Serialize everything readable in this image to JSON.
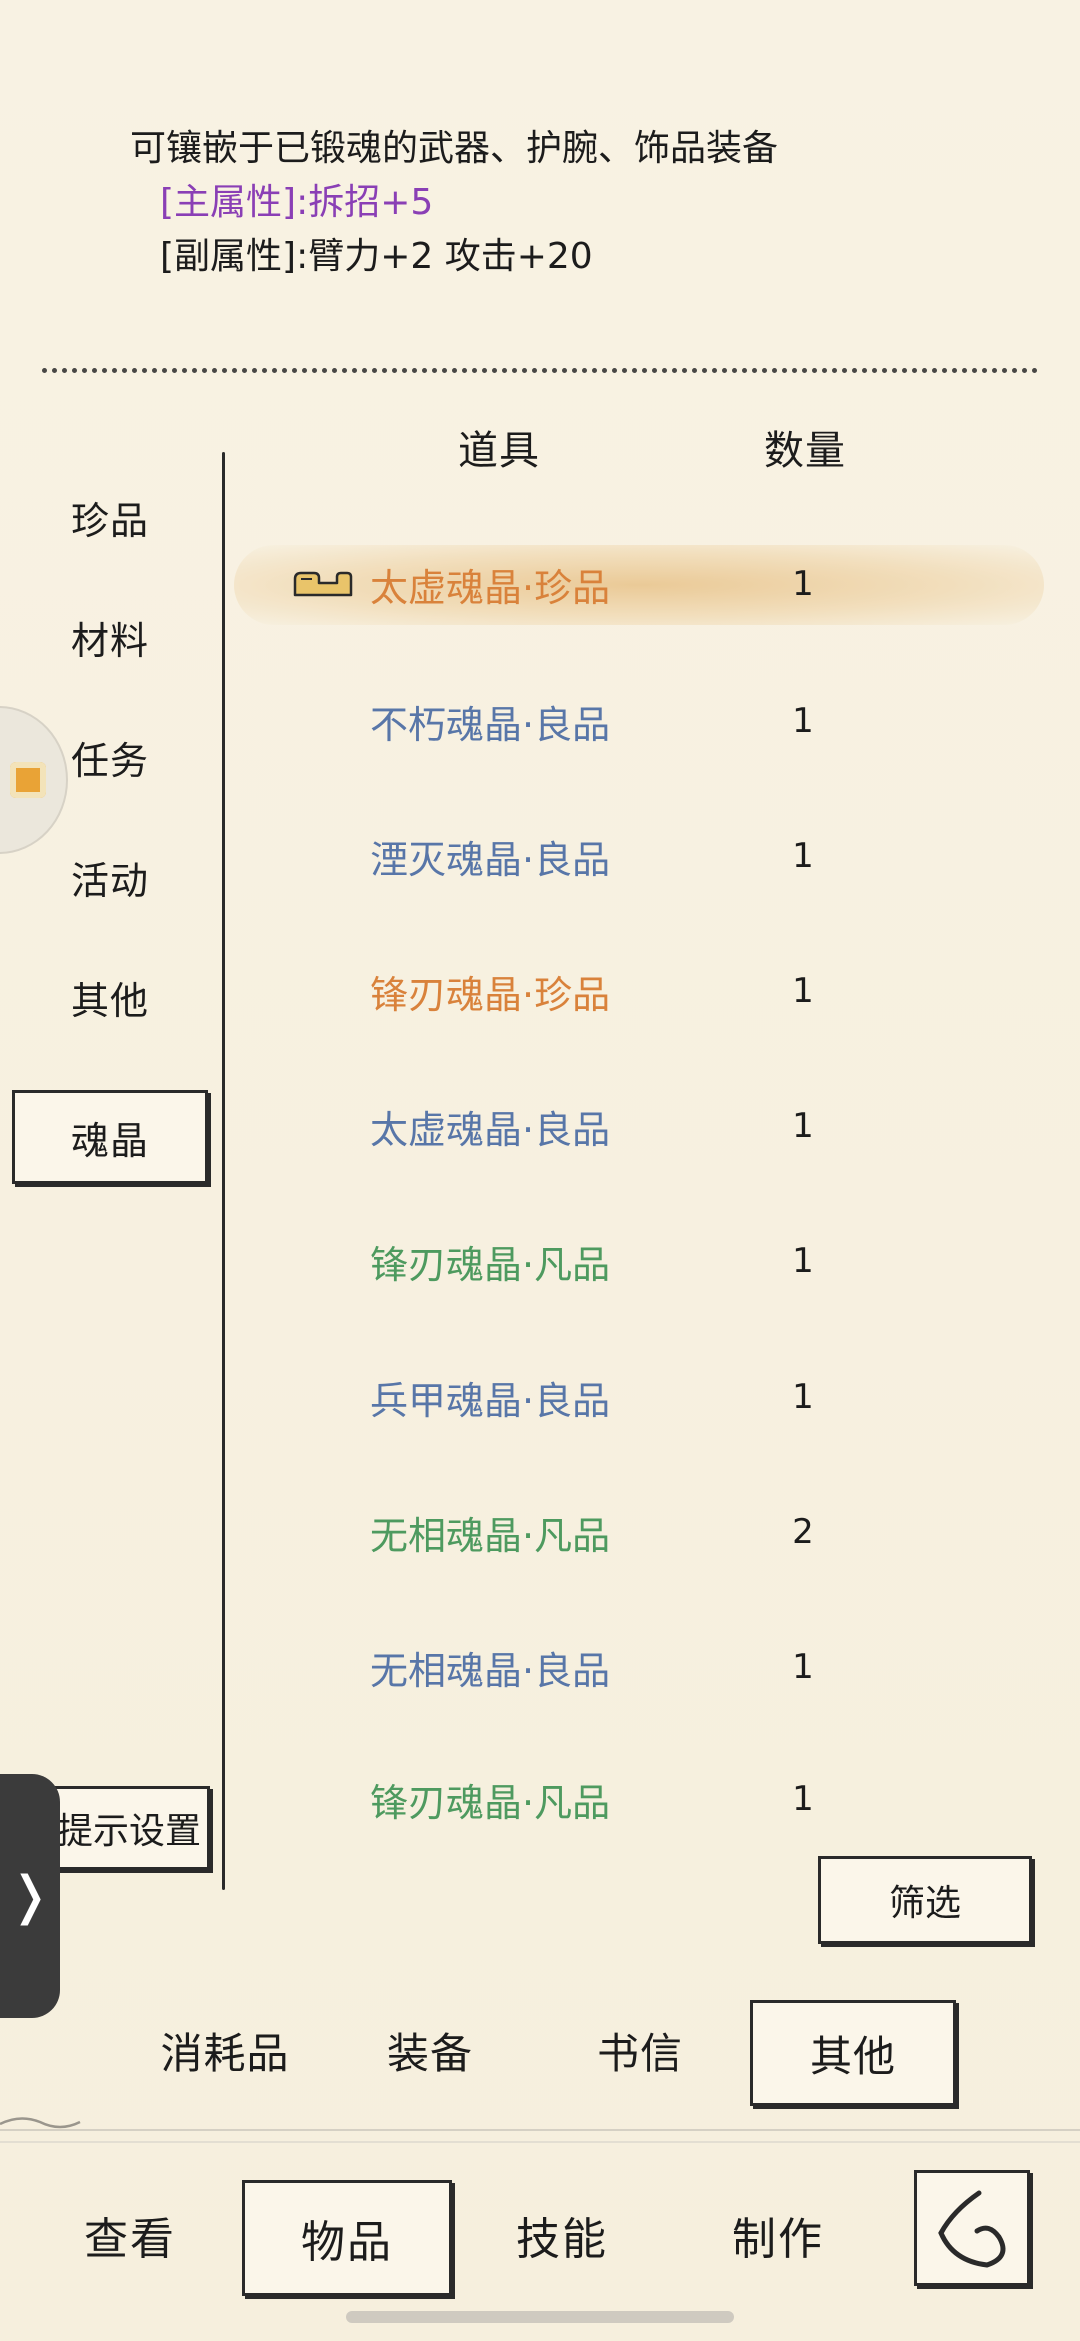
{
  "description": {
    "summary": "可镶嵌于已锻魂的武器、护腕、饰品装备",
    "main_attribute": "[主属性]:拆招+5",
    "sub_attribute": "[副属性]:臂力+2 攻击+20"
  },
  "categories": [
    "珍品",
    "材料",
    "任务",
    "活动",
    "其他",
    "魂晶"
  ],
  "active_category": "魂晶",
  "hint_settings_label": "提示设置",
  "table": {
    "header_item": "道具",
    "header_qty": "数量",
    "rows": [
      {
        "name": "太虚魂晶·珍品",
        "qty": "1",
        "color": "#d9823b",
        "selected": true,
        "equip_icon": "equipped-icon"
      },
      {
        "name": "不朽魂晶·良品",
        "qty": "1",
        "color": "#5876a8"
      },
      {
        "name": "湮灭魂晶·良品",
        "qty": "1",
        "color": "#5876a8"
      },
      {
        "name": "锋刃魂晶·珍品",
        "qty": "1",
        "color": "#d9823b"
      },
      {
        "name": "太虚魂晶·良品",
        "qty": "1",
        "color": "#5876a8"
      },
      {
        "name": "锋刃魂晶·凡品",
        "qty": "1",
        "color": "#4e9a5f"
      },
      {
        "name": "兵甲魂晶·良品",
        "qty": "1",
        "color": "#5876a8"
      },
      {
        "name": "无相魂晶·凡品",
        "qty": "2",
        "color": "#4e9a5f"
      },
      {
        "name": "无相魂晶·良品",
        "qty": "1",
        "color": "#5876a8"
      },
      {
        "name": "锋刃魂晶·凡品",
        "qty": "1",
        "color": "#4e9a5f"
      }
    ]
  },
  "filter_label": "筛选",
  "bottom_tabs": [
    "消耗品",
    "装备",
    "书信",
    "其他"
  ],
  "active_bottom_tab": "其他",
  "nav": [
    "查看",
    "物品",
    "技能",
    "制作"
  ],
  "active_nav": "物品",
  "side_tab_arrow": "❭",
  "colors": {
    "main_attribute": "#8a3fb5",
    "rarity_treasure": "#d9823b",
    "rarity_good": "#5876a8",
    "rarity_common": "#4e9a5f"
  }
}
